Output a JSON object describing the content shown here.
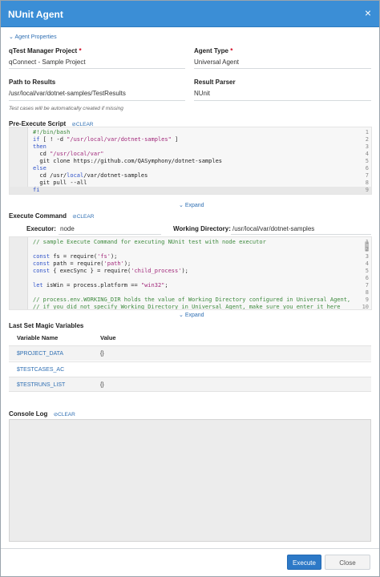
{
  "dialog": {
    "title": "NUnit Agent",
    "close_glyph": "×"
  },
  "agent_properties": {
    "toggle": "Agent Properties",
    "qtest_project": {
      "label": "qTest Manager Project",
      "required": "*",
      "value": "qConnect - Sample Project"
    },
    "agent_type": {
      "label": "Agent Type",
      "required": "*",
      "value": "Universal Agent"
    },
    "path_to_results": {
      "label": "Path to Results",
      "value": "/usr/local/var/dotnet-samples/TestResults"
    },
    "result_parser": {
      "label": "Result Parser",
      "value": "NUnit"
    },
    "note": "Test cases will be automatically created if missing"
  },
  "pre_execute": {
    "label": "Pre-Execute Script",
    "clear": "CLEAR",
    "lines": [
      {
        "n": "1",
        "parts": [
          {
            "t": "#!/bin/bash",
            "c": "cm"
          }
        ]
      },
      {
        "n": "2",
        "parts": [
          {
            "t": "if",
            "c": "kw"
          },
          {
            "t": " [ ! -d ",
            "c": "plain"
          },
          {
            "t": "\"/usr/local/var/dotnet-samples\"",
            "c": "str"
          },
          {
            "t": " ]",
            "c": "plain"
          }
        ]
      },
      {
        "n": "3",
        "parts": [
          {
            "t": "then",
            "c": "kw"
          }
        ]
      },
      {
        "n": "4",
        "parts": [
          {
            "t": "  cd ",
            "c": "plain"
          },
          {
            "t": "\"/usr/local/var\"",
            "c": "str"
          }
        ]
      },
      {
        "n": "5",
        "parts": [
          {
            "t": "  git clone https://github.com/QASymphony/dotnet-samples",
            "c": "plain"
          }
        ]
      },
      {
        "n": "6",
        "parts": [
          {
            "t": "else",
            "c": "kw"
          }
        ]
      },
      {
        "n": "7",
        "parts": [
          {
            "t": "  cd /usr/",
            "c": "plain"
          },
          {
            "t": "local",
            "c": "kw"
          },
          {
            "t": "/var/dotnet-samples",
            "c": "plain"
          }
        ]
      },
      {
        "n": "8",
        "parts": [
          {
            "t": "  git pull --all",
            "c": "plain"
          }
        ]
      },
      {
        "n": "9",
        "parts": [
          {
            "t": "fi",
            "c": "kw"
          }
        ]
      }
    ],
    "expand": "Expand"
  },
  "execute_command": {
    "label": "Execute Command",
    "clear": "CLEAR",
    "executor_label": "Executor:",
    "executor_value": "node",
    "working_dir_label": "Working Directory:",
    "working_dir_value": "/usr/local/var/dotnet-samples",
    "lines": [
      {
        "n": "1",
        "parts": [
          {
            "t": "// sample Execute Command for executing NUnit test with node executor",
            "c": "cm"
          }
        ]
      },
      {
        "n": "2",
        "parts": []
      },
      {
        "n": "3",
        "parts": [
          {
            "t": "const",
            "c": "kw"
          },
          {
            "t": " fs = require(",
            "c": "plain"
          },
          {
            "t": "'fs'",
            "c": "str"
          },
          {
            "t": ");",
            "c": "plain"
          }
        ]
      },
      {
        "n": "4",
        "parts": [
          {
            "t": "const",
            "c": "kw"
          },
          {
            "t": " path = require(",
            "c": "plain"
          },
          {
            "t": "'path'",
            "c": "str"
          },
          {
            "t": ");",
            "c": "plain"
          }
        ]
      },
      {
        "n": "5",
        "parts": [
          {
            "t": "const",
            "c": "kw"
          },
          {
            "t": " { execSync } = require(",
            "c": "plain"
          },
          {
            "t": "'child_process'",
            "c": "str"
          },
          {
            "t": ");",
            "c": "plain"
          }
        ]
      },
      {
        "n": "6",
        "parts": []
      },
      {
        "n": "7",
        "parts": [
          {
            "t": "let",
            "c": "kw"
          },
          {
            "t": " isWin = process.platform == ",
            "c": "plain"
          },
          {
            "t": "\"win32\"",
            "c": "str"
          },
          {
            "t": ";",
            "c": "plain"
          }
        ]
      },
      {
        "n": "8",
        "parts": []
      },
      {
        "n": "9",
        "parts": [
          {
            "t": "// process.env.WORKING_DIR holds the value of Working Directory configured in Universal Agent,",
            "c": "cm"
          }
        ]
      },
      {
        "n": "10",
        "parts": [
          {
            "t": "// if you did not specify Working Directory in Universal Agent, make sure you enter it here",
            "c": "cm"
          }
        ]
      }
    ],
    "expand": "Expand"
  },
  "magic_vars": {
    "label": "Last Set Magic Variables",
    "col_name": "Variable Name",
    "col_value": "Value",
    "rows": [
      {
        "name": "$PROJECT_DATA",
        "value": "{}"
      },
      {
        "name": "$TESTCASES_AC",
        "value": ""
      },
      {
        "name": "$TESTRUNS_LIST",
        "value": "{}"
      }
    ]
  },
  "console": {
    "label": "Console Log",
    "clear": "CLEAR"
  },
  "footer": {
    "execute": "Execute",
    "close": "Close"
  },
  "colors": {
    "title_bar": "#3b8ed6",
    "primary_button": "#2d79c7",
    "link": "#2f6fb3"
  }
}
